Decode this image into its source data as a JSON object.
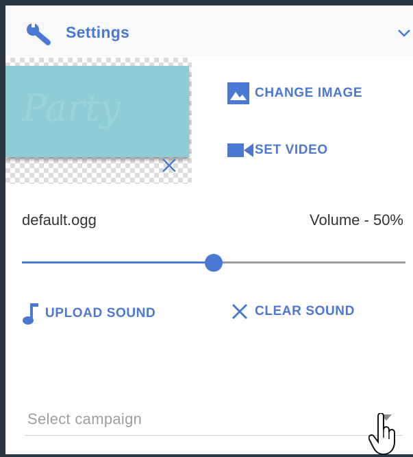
{
  "header": {
    "title": "Settings",
    "icon": "wrench-icon",
    "toggle_icon": "chevron-down-icon"
  },
  "media": {
    "change_image_label": "CHANGE IMAGE",
    "change_image_icon": "image-icon",
    "set_video_label": "SET VIDEO",
    "set_video_icon": "video-camera-icon",
    "remove_image_icon": "close-icon"
  },
  "sound": {
    "file_name": "default.ogg",
    "volume_label": "Volume - 50%",
    "volume_fraction": 0.5,
    "upload_label": "UPLOAD SOUND",
    "upload_icon": "music-note-icon",
    "clear_label": "CLEAR SOUND",
    "clear_icon": "close-icon"
  },
  "campaign": {
    "placeholder": "Select campaign",
    "dropdown_icon": "caret-down-icon"
  },
  "colors": {
    "accent": "#4a78d2",
    "frame": "#2b3743",
    "header_bg": "#f7f8fa",
    "preview_fill": "#8dcdd3"
  }
}
